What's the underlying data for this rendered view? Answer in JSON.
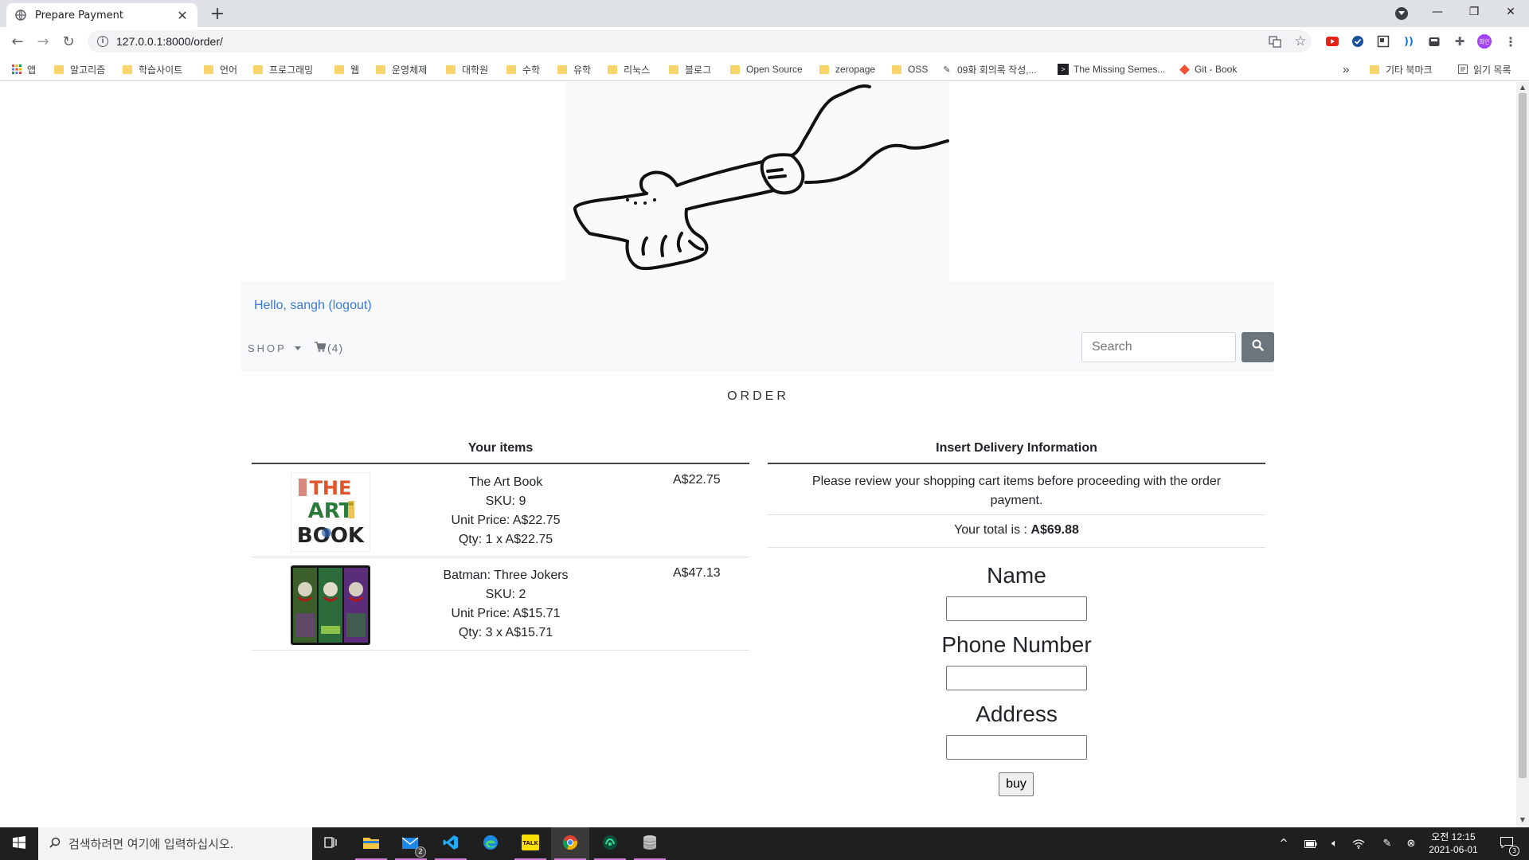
{
  "browser": {
    "tab_title": "Prepare Payment",
    "url": "127.0.0.1:8000/order/",
    "profile_initial": "희민"
  },
  "bookmarks": [
    {
      "label": "앱",
      "type": "apps"
    },
    {
      "label": "알고리즘",
      "type": "folder"
    },
    {
      "label": "학습사이트",
      "type": "folder"
    },
    {
      "label": "언어",
      "type": "folder"
    },
    {
      "label": "프로그래밍",
      "type": "folder"
    },
    {
      "label": "웹",
      "type": "folder"
    },
    {
      "label": "운영체제",
      "type": "folder"
    },
    {
      "label": "대학원",
      "type": "folder"
    },
    {
      "label": "수학",
      "type": "folder"
    },
    {
      "label": "유학",
      "type": "folder"
    },
    {
      "label": "리눅스",
      "type": "folder"
    },
    {
      "label": "블로그",
      "type": "folder"
    },
    {
      "label": "Open Source",
      "type": "folder"
    },
    {
      "label": "zeropage",
      "type": "folder"
    },
    {
      "label": "OSS",
      "type": "folder"
    },
    {
      "label": "09화 회의록 작성,...",
      "type": "page"
    },
    {
      "label": "The Missing Semes...",
      "type": "page"
    },
    {
      "label": "Git - Book",
      "type": "page"
    }
  ],
  "bookmarks_overflow": "»",
  "other_bookmarks": "기타 북마크",
  "reading_list": "읽기 목록",
  "site": {
    "greeting": "Hello, sangh (logout)",
    "shop_label": "SHOP",
    "cart_count": "(4)",
    "search_placeholder": "Search"
  },
  "order": {
    "title": "ORDER",
    "items_header": "Your items",
    "items": [
      {
        "name": "The Art Book",
        "sku": "SKU: 9",
        "unit_price": "Unit Price: A$22.75",
        "qty": "Qty: 1 x A$22.75",
        "total": "A$22.75",
        "cover_text": [
          "THE",
          "ART",
          "BOOK"
        ]
      },
      {
        "name": "Batman: Three Jokers",
        "sku": "SKU: 2",
        "unit_price": "Unit Price: A$15.71",
        "qty": "Qty: 3 x A$15.71",
        "total": "A$47.13"
      }
    ],
    "delivery_header": "Insert Delivery Information",
    "review_text": "Please review your shopping cart items before proceeding with the order payment.",
    "total_label": "Your total is : ",
    "total_value": "A$69.88",
    "fields": {
      "name_label": "Name",
      "phone_label": "Phone Number",
      "address_label": "Address"
    },
    "buy_label": "buy"
  },
  "taskbar": {
    "search_placeholder": "검색하려면 여기에 입력하십시오.",
    "mail_badge": "2",
    "time": "오전 12:15",
    "date": "2021-06-01",
    "notification_count": "3"
  },
  "colors": {
    "link": "#3a7bd5",
    "navbar_bg": "#f8f9fa",
    "search_button": "#6c757d",
    "taskbar": "#1f1f1f"
  }
}
